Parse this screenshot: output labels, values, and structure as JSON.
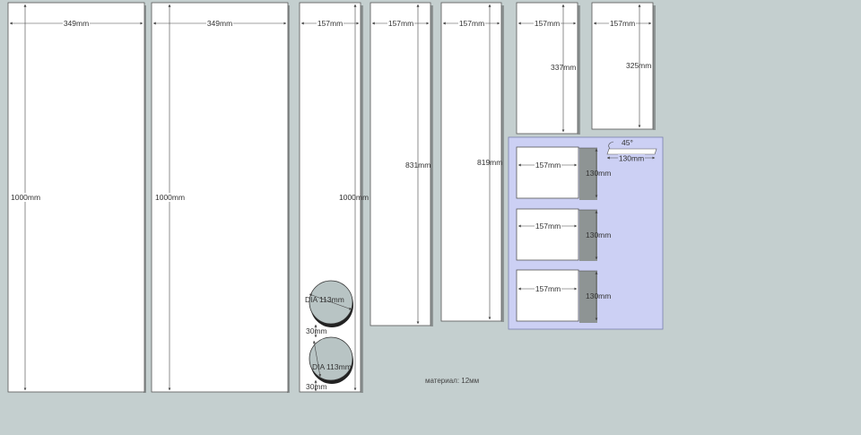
{
  "panels": [
    {
      "width_label": "349mm",
      "height_label": "1000mm"
    },
    {
      "width_label": "349mm",
      "height_label": "1000mm"
    },
    {
      "width_label": "157mm",
      "height_label": "1000mm"
    },
    {
      "width_label": "157mm",
      "height_label": "831mm"
    },
    {
      "width_label": "157mm",
      "height_label": "819mm"
    },
    {
      "width_label": "157mm",
      "height_label": "337mm"
    },
    {
      "width_label": "157mm",
      "height_label": "325mm"
    }
  ],
  "circles": [
    {
      "dia_label": "DIA 113mm"
    },
    {
      "dia_label": "DIA 113mm"
    }
  ],
  "gaps": [
    "30mm",
    "30mm"
  ],
  "small_parts": [
    {
      "width_label": "157mm",
      "height_label": "130mm"
    },
    {
      "width_label": "157mm",
      "height_label": "130mm"
    },
    {
      "width_label": "157mm",
      "height_label": "130mm"
    }
  ],
  "bevel": {
    "angle_label": "45°",
    "length_label": "130mm"
  },
  "material_label": "материал: 12мм",
  "colors": {
    "background": "#c4cfcf",
    "panel": "#ffffff",
    "highlight": "#ccd0f4"
  }
}
